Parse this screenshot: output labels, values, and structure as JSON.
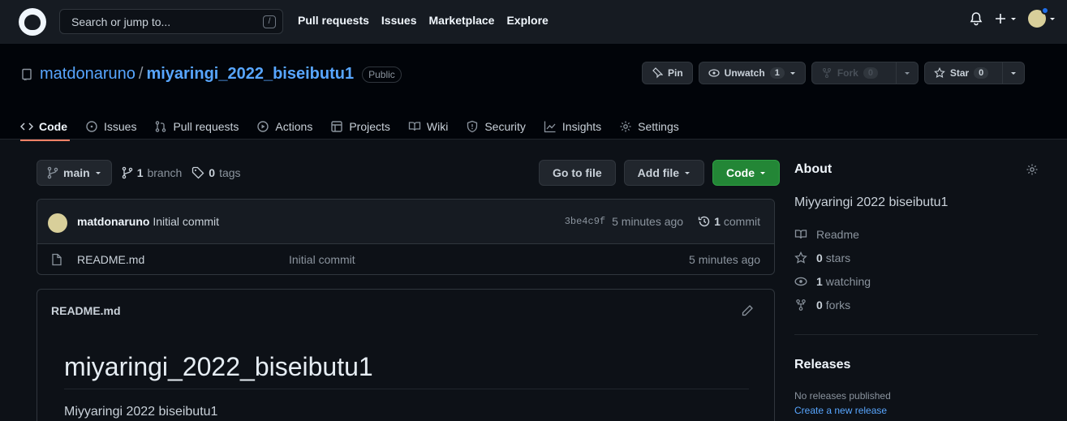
{
  "header": {
    "search_placeholder": "Search or jump to...",
    "search_shortcut": "/",
    "nav": [
      "Pull requests",
      "Issues",
      "Marketplace",
      "Explore"
    ]
  },
  "repo": {
    "owner": "matdonaruno",
    "separator": "/",
    "name": "miyaringi_2022_biseibutu1",
    "visibility": "Public",
    "pin_label": "Pin",
    "unwatch_label": "Unwatch",
    "unwatch_count": "1",
    "fork_label": "Fork",
    "fork_count": "0",
    "star_label": "Star",
    "star_count": "0"
  },
  "tabs": [
    "Code",
    "Issues",
    "Pull requests",
    "Actions",
    "Projects",
    "Wiki",
    "Security",
    "Insights",
    "Settings"
  ],
  "branch_bar": {
    "branch": "main",
    "branch_count": "1",
    "branch_word": "branch",
    "tag_count": "0",
    "tag_word": "tags",
    "go_to_file": "Go to file",
    "add_file": "Add file",
    "code": "Code"
  },
  "latest_commit": {
    "author": "matdonaruno",
    "message": "Initial commit",
    "sha": "3be4c9f",
    "time": "5 minutes ago",
    "commit_count": "1",
    "commit_word": "commit"
  },
  "files": [
    {
      "name": "README.md",
      "message": "Initial commit",
      "time": "5 minutes ago"
    }
  ],
  "readme": {
    "header": "README.md",
    "title": "miyaringi_2022_biseibutu1",
    "body": "Miyyaringi 2022 biseibutu1"
  },
  "about": {
    "heading": "About",
    "description": "Miyyaringi 2022 biseibutu1",
    "readme": "Readme",
    "stars_count": "0",
    "stars_word": "stars",
    "watching_count": "1",
    "watching_word": "watching",
    "forks_count": "0",
    "forks_word": "forks"
  },
  "releases": {
    "heading": "Releases",
    "none": "No releases published",
    "create": "Create a new release"
  },
  "colors": {
    "accent_link": "#58a6ff",
    "green_button": "#238636",
    "active_tab_underline": "#f78166",
    "background": "#0d1117"
  }
}
